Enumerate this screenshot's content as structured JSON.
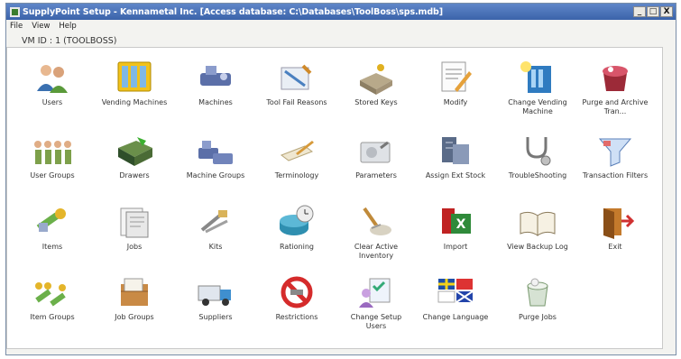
{
  "window": {
    "title": "SupplyPoint Setup - Kennametal Inc. [Access database: C:\\Databases\\ToolBoss\\sps.mdb]",
    "controls": [
      "_",
      "□",
      "X"
    ]
  },
  "menu": {
    "file": "File",
    "view": "View",
    "help": "Help"
  },
  "vm_id": "VM ID : 1 (TOOLBOSS)",
  "tiles": [
    {
      "label": "Users",
      "icon": "users-icon"
    },
    {
      "label": "Vending Machines",
      "icon": "vending-machines-icon"
    },
    {
      "label": "Machines",
      "icon": "machines-icon"
    },
    {
      "label": "Tool Fail Reasons",
      "icon": "tool-fail-reasons-icon"
    },
    {
      "label": "Stored Keys",
      "icon": "stored-keys-icon"
    },
    {
      "label": "Modify",
      "icon": "modify-icon"
    },
    {
      "label": "Change Vending Machine",
      "icon": "change-vending-machine-icon"
    },
    {
      "label": "Purge and Archive Tran...",
      "icon": "purge-archive-icon"
    },
    {
      "label": "User Groups",
      "icon": "user-groups-icon"
    },
    {
      "label": "Drawers",
      "icon": "drawers-icon"
    },
    {
      "label": "Machine Groups",
      "icon": "machine-groups-icon"
    },
    {
      "label": "Terminology",
      "icon": "terminology-icon"
    },
    {
      "label": "Parameters",
      "icon": "parameters-icon"
    },
    {
      "label": "Assign Ext Stock",
      "icon": "assign-ext-stock-icon"
    },
    {
      "label": "TroubleShooting",
      "icon": "stethoscope-icon"
    },
    {
      "label": "Transaction Filters",
      "icon": "transaction-filters-icon"
    },
    {
      "label": "Items",
      "icon": "items-icon"
    },
    {
      "label": "Jobs",
      "icon": "jobs-icon"
    },
    {
      "label": "Kits",
      "icon": "kits-icon"
    },
    {
      "label": "Rationing",
      "icon": "rationing-icon"
    },
    {
      "label": "Clear Active Inventory",
      "icon": "clear-inventory-icon"
    },
    {
      "label": "Import",
      "icon": "import-excel-icon"
    },
    {
      "label": "View Backup Log",
      "icon": "backup-log-book-icon"
    },
    {
      "label": "Exit",
      "icon": "exit-door-icon"
    },
    {
      "label": "Item Groups",
      "icon": "item-groups-icon"
    },
    {
      "label": "Job Groups",
      "icon": "job-groups-icon"
    },
    {
      "label": "Suppliers",
      "icon": "suppliers-truck-icon"
    },
    {
      "label": "Restrictions",
      "icon": "restrictions-icon"
    },
    {
      "label": "Change Setup Users",
      "icon": "change-setup-users-icon"
    },
    {
      "label": "Change Language",
      "icon": "flags-icon"
    },
    {
      "label": "Purge Jobs",
      "icon": "purge-jobs-icon"
    }
  ]
}
